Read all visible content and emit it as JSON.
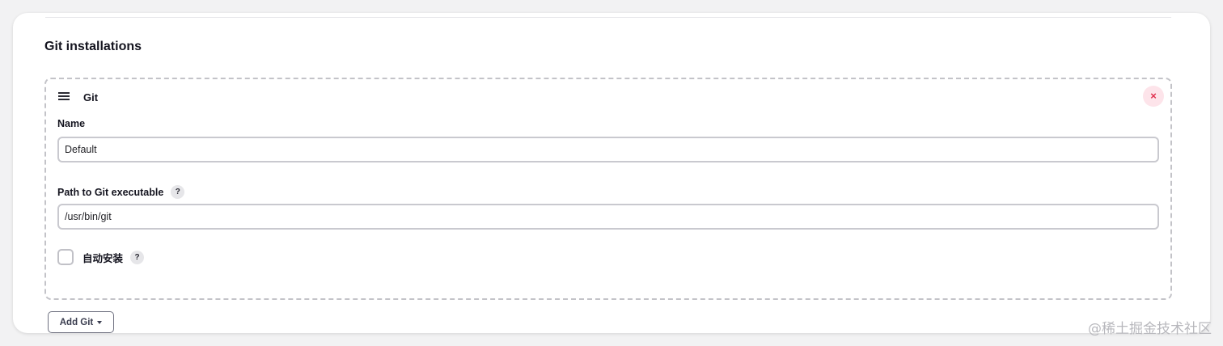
{
  "section": {
    "title": "Git installations"
  },
  "git_block": {
    "title": "Git",
    "delete_symbol": "×",
    "name_field": {
      "label": "Name",
      "value": "Default"
    },
    "path_field": {
      "label": "Path to Git executable",
      "value": "/usr/bin/git",
      "help_symbol": "?"
    },
    "auto_install": {
      "label": "自动安装",
      "checked": false,
      "help_symbol": "?"
    }
  },
  "add_button": {
    "label": "Add Git"
  },
  "watermark": {
    "text": "@稀土掘金技术社区"
  },
  "colors": {
    "delete_accent": "#e0304e",
    "delete_bg": "#fde4ea",
    "border": "#c3c3c8"
  },
  "icons": [
    "drag-handle-icon",
    "close-icon",
    "help-icon",
    "caret-down-icon"
  ]
}
